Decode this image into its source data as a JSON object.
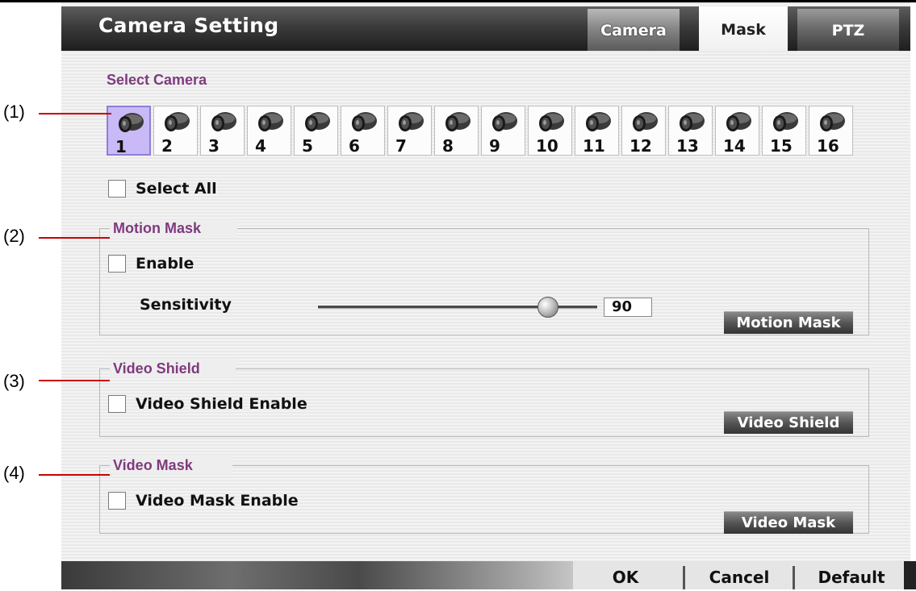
{
  "header": {
    "title": "Camera Setting"
  },
  "tabs": [
    {
      "label": "Camera"
    },
    {
      "label": "Mask"
    },
    {
      "label": "PTZ"
    }
  ],
  "select_camera": {
    "title": "Select Camera",
    "cameras": [
      "1",
      "2",
      "3",
      "4",
      "5",
      "6",
      "7",
      "8",
      "9",
      "10",
      "11",
      "12",
      "13",
      "14",
      "15",
      "16"
    ],
    "selected": "1",
    "select_all_label": "Select All"
  },
  "motion_mask": {
    "title": "Motion Mask",
    "enable_label": "Enable",
    "sensitivity_label": "Sensitivity",
    "sensitivity_value": "90",
    "button_label": "Motion Mask"
  },
  "video_shield": {
    "title": "Video Shield",
    "enable_label": "Video Shield Enable",
    "button_label": "Video Shield"
  },
  "video_mask": {
    "title": "Video Mask",
    "enable_label": "Video Mask Enable",
    "button_label": "Video Mask"
  },
  "footer": {
    "ok": "OK",
    "cancel": "Cancel",
    "default": "Default"
  },
  "annotations": [
    "(1)",
    "(2)",
    "(3)",
    "(4)"
  ],
  "colors": {
    "section_title": "#7f3a7e",
    "annotation_line": "#cc0000",
    "selected_camera": "#c9b9f7"
  }
}
